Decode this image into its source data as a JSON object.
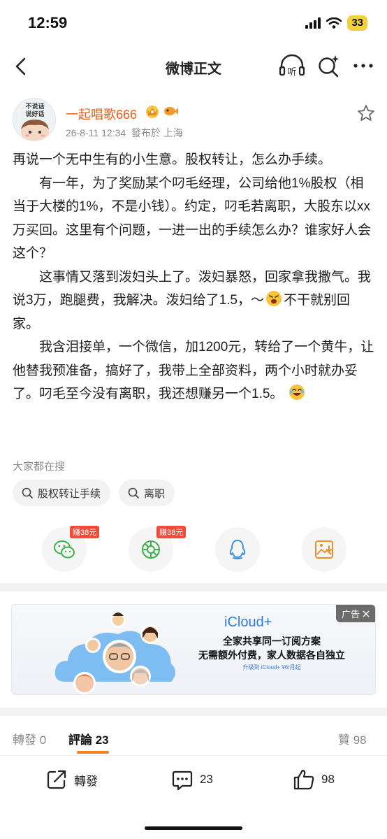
{
  "status": {
    "time": "12:59",
    "battery": "33"
  },
  "nav": {
    "title": "微博正文",
    "back_icon": "chevron-left-icon",
    "listen_icon": "headphones-icon",
    "search_icon": "search-sparkle-icon",
    "more_icon": "more-dots-icon",
    "listen_label": "听"
  },
  "post": {
    "author": "一起唱歌666",
    "avatar_text": [
      "不说话",
      "说好话"
    ],
    "meta": "26-8-11 12:34  發布於 上海",
    "paragraphs": [
      "再说一个无中生有的小生意。股权转让，怎么办手续。",
      "　　有一年，为了奖励某个叼毛经理，公司给他1%股权（相当于大楼的1%，不是小钱）。约定，叼毛若离职，大股东以xx万买回。这里有个问题，一进一出的手续怎么办？谁家好人会这个？",
      "　　这事情又落到泼妇头上了。泼妇暴怒，回家拿我撒气。我说3万，跑腿费，我解决。泼妇给了1.5，～",
      "不干就别回家。",
      "　　我含泪接单，一个微信，加1200元，转给了一个黄牛，让他替我预准备，搞好了，我带上全部资料，两个小时就办妥了。叼毛至今没有离职，我还想赚另一个1.5。"
    ]
  },
  "search": {
    "heading": "大家都在搜",
    "chips": [
      "股权转让手续",
      "离职"
    ]
  },
  "share": {
    "earn_label": "赚38元",
    "items": [
      "wechat-icon",
      "moments-icon",
      "qq-icon",
      "save-image-icon"
    ]
  },
  "ad": {
    "tag": "广告",
    "title": "iCloud+",
    "line1": "全家共享同一订阅方案",
    "line2": "无需额外付费，家人数据各自独立",
    "line3": "升级到 iCloud+ ¥6/月起"
  },
  "tabs": {
    "repost": "轉發 0",
    "comment": "評論 23",
    "like": "贊 98"
  },
  "toolbar": {
    "repost": "轉發",
    "comment_count": "23",
    "like_count": "98"
  },
  "colors": {
    "accent": "#ea5d1e",
    "tab_underline": "#f5821f",
    "earn_tag": "#f14c3a",
    "ad_title": "#2b7de3"
  }
}
